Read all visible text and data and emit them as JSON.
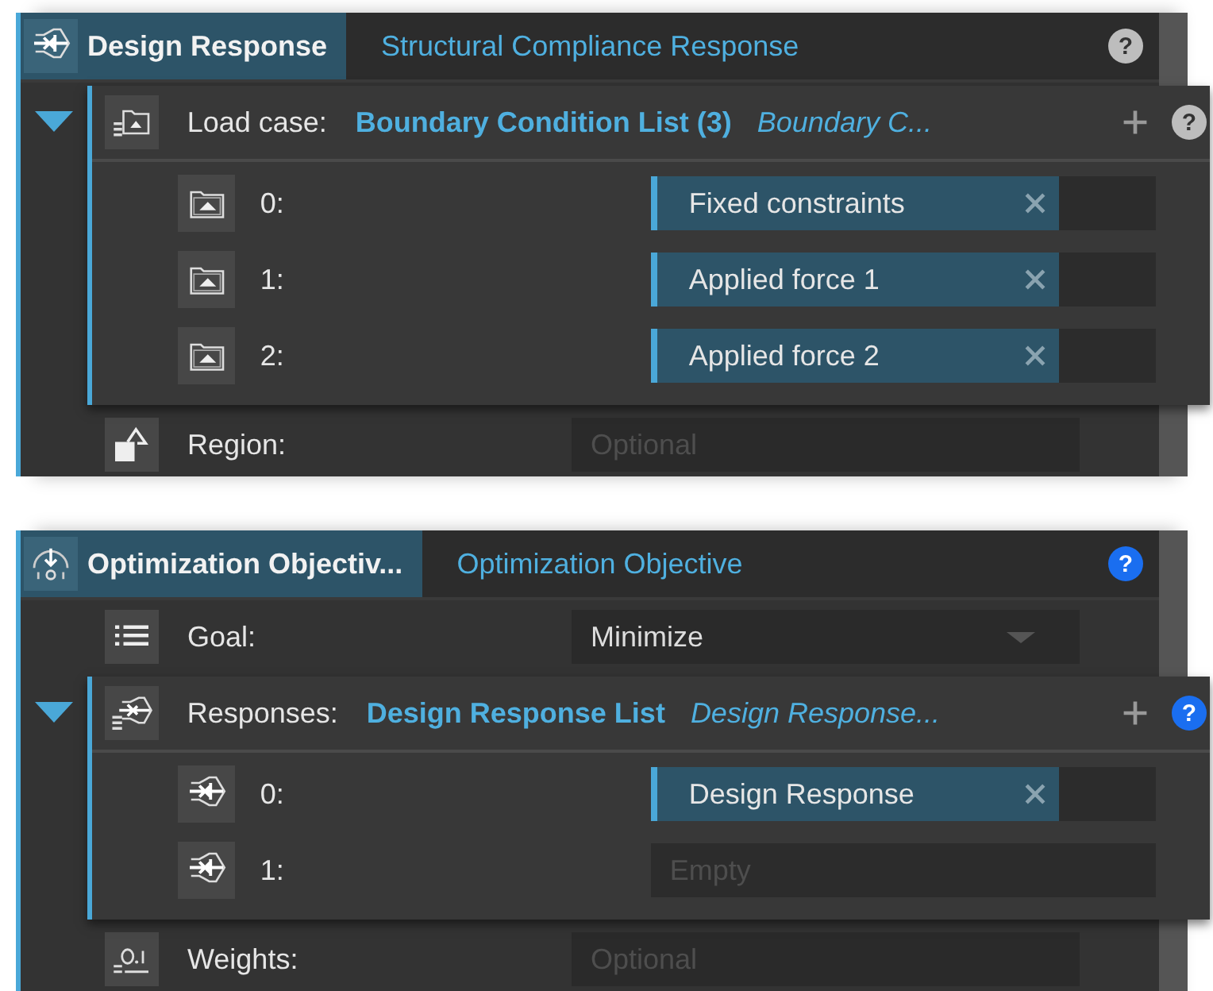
{
  "panels": [
    {
      "tabs": [
        {
          "label": "Design Response",
          "selected": true
        },
        {
          "label": "Structural Compliance Response",
          "selected": false
        }
      ],
      "help": {
        "text": "?",
        "highlighted": false
      },
      "rows": [
        {
          "kind": "list",
          "label": "Load case:",
          "expanded": true,
          "list_type": "Boundary Condition List (3)",
          "element_type": "Boundary C...",
          "help": {
            "text": "?",
            "highlighted": false
          },
          "items": [
            {
              "index": "0:",
              "value": "Fixed constraints"
            },
            {
              "index": "1:",
              "value": "Applied force 1"
            },
            {
              "index": "2:",
              "value": "Applied force 2"
            }
          ]
        },
        {
          "kind": "field",
          "label": "Region:",
          "placeholder": "Optional"
        }
      ]
    },
    {
      "tabs": [
        {
          "label": "Optimization Objectiv...",
          "selected": true
        },
        {
          "label": "Optimization Objective",
          "selected": false
        }
      ],
      "help": {
        "text": "?",
        "highlighted": true
      },
      "rows": [
        {
          "kind": "dropdown",
          "label": "Goal:",
          "value": "Minimize"
        },
        {
          "kind": "list",
          "label": "Responses:",
          "expanded": true,
          "list_type": "Design Response List",
          "element_type": "Design Response...",
          "help": {
            "text": "?",
            "highlighted": true
          },
          "items": [
            {
              "index": "0:",
              "value": "Design Response"
            },
            {
              "index": "1:",
              "placeholder": "Empty"
            }
          ]
        },
        {
          "kind": "field",
          "label": "Weights:",
          "placeholder": "Optional"
        }
      ]
    }
  ]
}
